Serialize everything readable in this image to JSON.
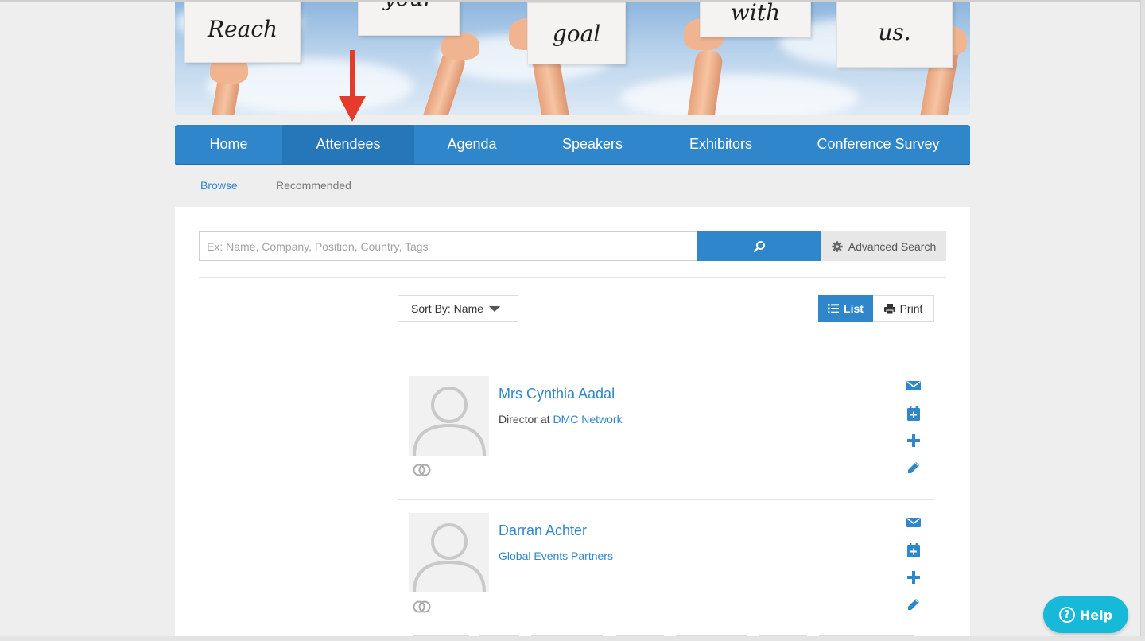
{
  "banner": {
    "signs": [
      "Reach",
      "your",
      "goal",
      "with",
      "us."
    ]
  },
  "nav": {
    "items": [
      {
        "label": "Home"
      },
      {
        "label": "Attendees",
        "active": true
      },
      {
        "label": "Agenda"
      },
      {
        "label": "Speakers"
      },
      {
        "label": "Exhibitors"
      },
      {
        "label": "Conference Survey"
      }
    ]
  },
  "subnav": {
    "browse": "Browse",
    "recommended": "Recommended"
  },
  "search": {
    "placeholder": "Ex: Name, Company, Position, Country, Tags",
    "advanced_label": "Advanced Search"
  },
  "toolbar": {
    "sort_label": "Sort By: Name",
    "list_label": "List",
    "print_label": "Print"
  },
  "attendees": [
    {
      "name": "Mrs Cynthia Aadal",
      "position_prefix": "Director at ",
      "company": "DMC Network"
    },
    {
      "name": "Darran Achter",
      "position_prefix": "",
      "company": "Global Events Partners"
    }
  ],
  "help": {
    "label": "Help"
  },
  "colors": {
    "accent": "#2f86cb",
    "nav_active": "#2677b9",
    "help": "#16b9d8",
    "arrow": "#e53b2c"
  },
  "icons": [
    "search-icon",
    "gear-icon",
    "list-icon",
    "print-icon",
    "envelope-icon",
    "calendar-add-icon",
    "plus-icon",
    "pencil-icon",
    "connections-icon",
    "question-icon"
  ]
}
